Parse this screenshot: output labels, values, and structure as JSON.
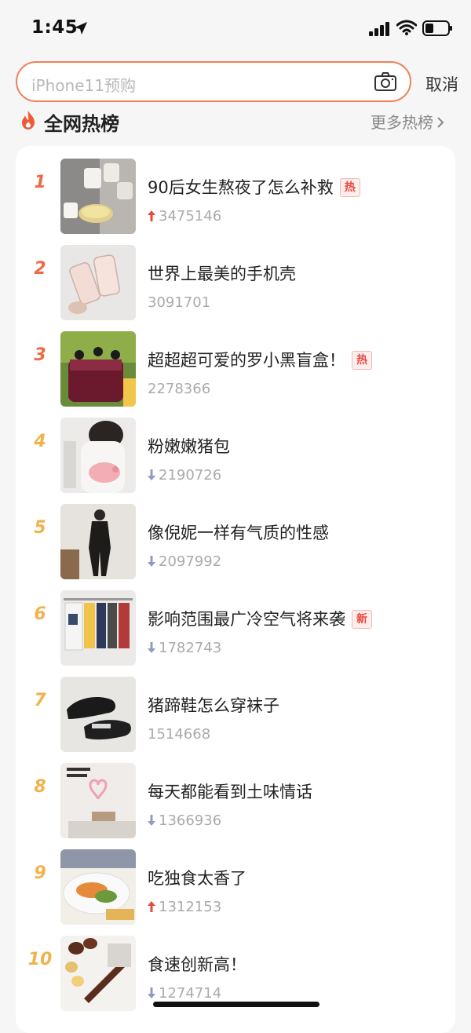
{
  "status_bar": {
    "time": "1:45"
  },
  "search": {
    "placeholder": "iPhone11预购",
    "cancel_label": "取消"
  },
  "hot_list": {
    "title": "全网热榜",
    "more_label": "更多热榜",
    "items": [
      {
        "rank": "1",
        "title": "90后女生熬夜了怎么补救",
        "badge": "热",
        "trend": "up",
        "count": "3475146",
        "rank_color": "#ef6a44"
      },
      {
        "rank": "2",
        "title": "世界上最美的手机壳",
        "badge": "",
        "trend": "none",
        "count": "3091701",
        "rank_color": "#ef6a44"
      },
      {
        "rank": "3",
        "title": "超超超可爱的罗小黑盲盒！",
        "badge": "热",
        "trend": "none",
        "count": "2278366",
        "rank_color": "#ef6a44"
      },
      {
        "rank": "4",
        "title": "粉嫩嫩猪包",
        "badge": "",
        "trend": "down",
        "count": "2190726",
        "rank_color": "#f1b24e"
      },
      {
        "rank": "5",
        "title": "像倪妮一样有气质的性感",
        "badge": "",
        "trend": "down",
        "count": "2097992",
        "rank_color": "#f1b24e"
      },
      {
        "rank": "6",
        "title": "影响范围最广冷空气将来袭",
        "badge": "新",
        "trend": "down",
        "count": "1782743",
        "rank_color": "#f1b24e"
      },
      {
        "rank": "7",
        "title": "猪蹄鞋怎么穿袜子",
        "badge": "",
        "trend": "none",
        "count": "1514668",
        "rank_color": "#f1b24e"
      },
      {
        "rank": "8",
        "title": "每天都能看到土味情话",
        "badge": "",
        "trend": "down",
        "count": "1366936",
        "rank_color": "#f1b24e"
      },
      {
        "rank": "9",
        "title": "吃独食太香了",
        "badge": "",
        "trend": "up",
        "count": "1312153",
        "rank_color": "#f1b24e"
      },
      {
        "rank": "10",
        "title": "食速创新高！",
        "badge": "",
        "trend": "down",
        "count": "1274714",
        "rank_color": "#f1b24e"
      }
    ]
  },
  "colors": {
    "accent": "#f0805a",
    "up": "#e8493c",
    "down": "#8f9bc0"
  }
}
